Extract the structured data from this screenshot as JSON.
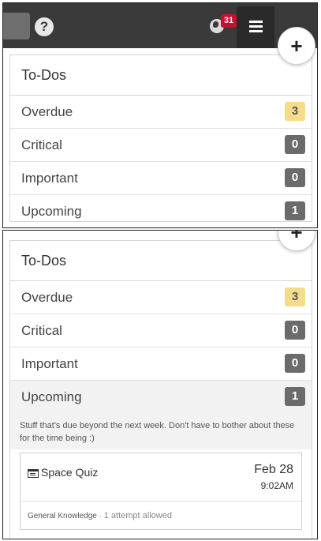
{
  "topbar": {
    "help_icon": "question-circle-icon",
    "globe_icon": "globe-icon",
    "notification_count": "31",
    "list_icon": "list-icon"
  },
  "add_button": {
    "label": "+"
  },
  "todos_summary": {
    "title": "To-Dos",
    "rows": [
      {
        "label": "Overdue",
        "count": "3"
      },
      {
        "label": "Critical",
        "count": "0"
      },
      {
        "label": "Important",
        "count": "0"
      },
      {
        "label": "Upcoming",
        "count": "1"
      }
    ]
  },
  "todos_expanded": {
    "title": "To-Dos",
    "rows": [
      {
        "label": "Overdue",
        "count": "3"
      },
      {
        "label": "Critical",
        "count": "0"
      },
      {
        "label": "Important",
        "count": "0"
      },
      {
        "label": "Upcoming",
        "count": "1"
      }
    ],
    "upcoming_description": "Stuff that's due beyond the next week. Don't have to bother about these for the time being :)",
    "event": {
      "icon": "calendar-list-icon",
      "title": "Space Quiz",
      "date": "Feb 28",
      "time": "9:02AM",
      "course": "General Knowledge",
      "separator": "·",
      "attempts": "1 attempt allowed"
    }
  },
  "colors": {
    "topbar_bg": "#3a3a3a",
    "notification_badge": "#c8102e",
    "overdue_badge": "#f5dc8a",
    "count_badge": "#6b6b6b"
  }
}
